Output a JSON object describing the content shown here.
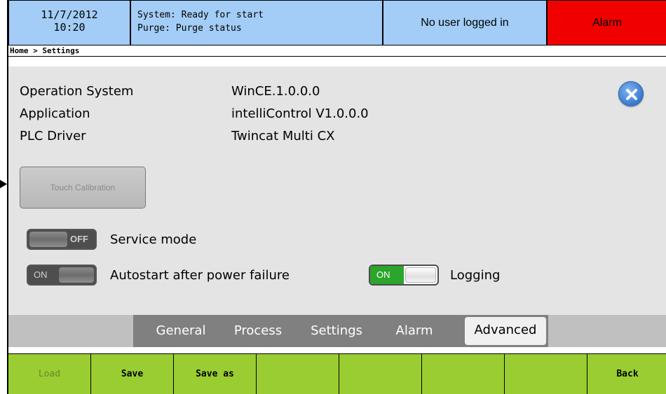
{
  "header": {
    "date": "11/7/2012",
    "time": "10:20",
    "system_status": "System: Ready for start",
    "purge_status": "Purge: Purge status",
    "user": "No user logged in",
    "alarm": "Alarm"
  },
  "breadcrumb": "Home > Settings",
  "info": [
    {
      "label": "Operation System",
      "value": "WinCE.1.0.0.0"
    },
    {
      "label": "Application",
      "value": "intelliControl V1.0.0.0"
    },
    {
      "label": "PLC Driver",
      "value": "Twincat Multi CX"
    }
  ],
  "touch_calibration": "Touch Calibration",
  "toggles": {
    "service_mode": {
      "label": "Service mode",
      "state": "OFF"
    },
    "autostart": {
      "label": "Autostart after power failure",
      "state": "ON"
    },
    "logging": {
      "label": "Logging",
      "state": "ON"
    }
  },
  "tabs": [
    "General",
    "Process",
    "Settings",
    "Alarm",
    "Advanced"
  ],
  "active_tab": "Advanced",
  "buttons": [
    "Load",
    "Save",
    "Save as",
    "",
    "",
    "",
    "",
    "Back"
  ],
  "colors": {
    "header_bg": "#a3cdf6",
    "alarm_bg": "#f10000",
    "button_bar": "#9acd32",
    "toggle_on": "#2ba52b"
  },
  "icons": {
    "close": "close-icon"
  }
}
